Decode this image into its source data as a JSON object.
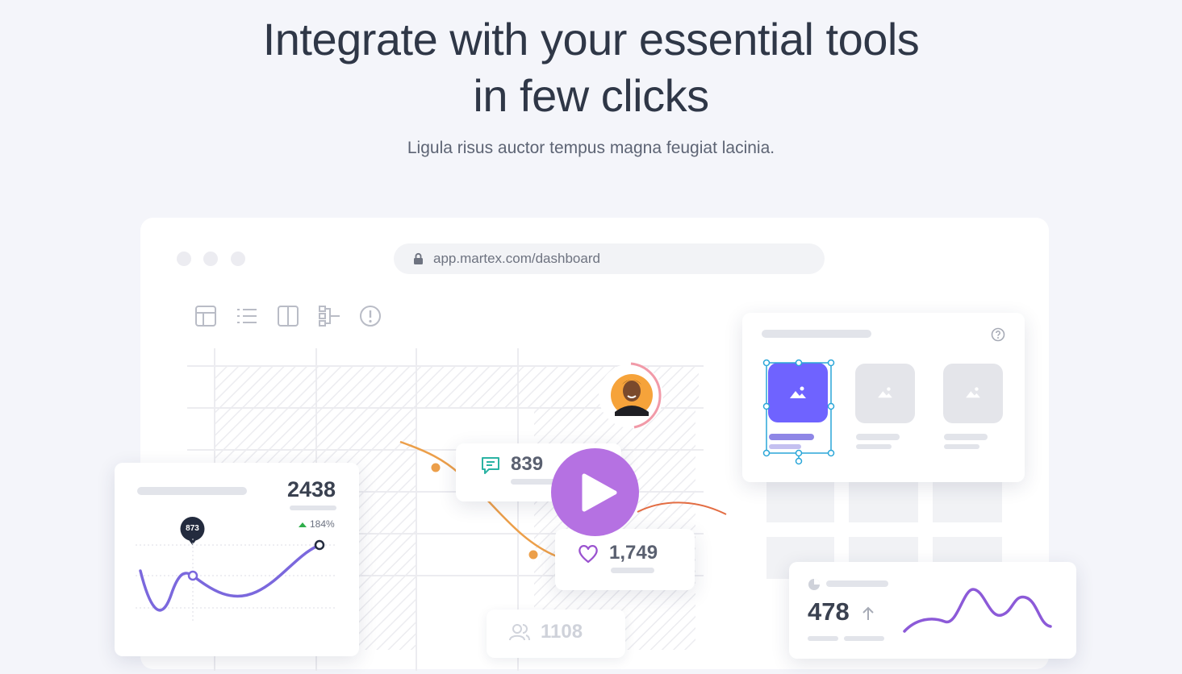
{
  "hero": {
    "title_line1": "Integrate with your essential tools",
    "title_line2": "in few clicks",
    "subtitle": "Ligula risus auctor tempus magna feugiat lacinia."
  },
  "browser": {
    "url": "app.martex.com/dashboard"
  },
  "toolbar_icons": [
    "table-icon",
    "list-icon",
    "columns-icon",
    "hierarchy-icon",
    "alert-icon"
  ],
  "stats": {
    "main_value": "2438",
    "growth": "184%",
    "marker_value": "873",
    "comments": "839",
    "likes": "1,749",
    "users": "1108",
    "secondary_value": "478"
  },
  "colors": {
    "accent_purple": "#6f63ff",
    "play_button": "#b571e2",
    "line_purple": "#7b68dd",
    "teal": "#2bb3a3",
    "orange": "#ec9f4a",
    "growth_green": "#2fae4a",
    "heart": "#9a52cf"
  }
}
